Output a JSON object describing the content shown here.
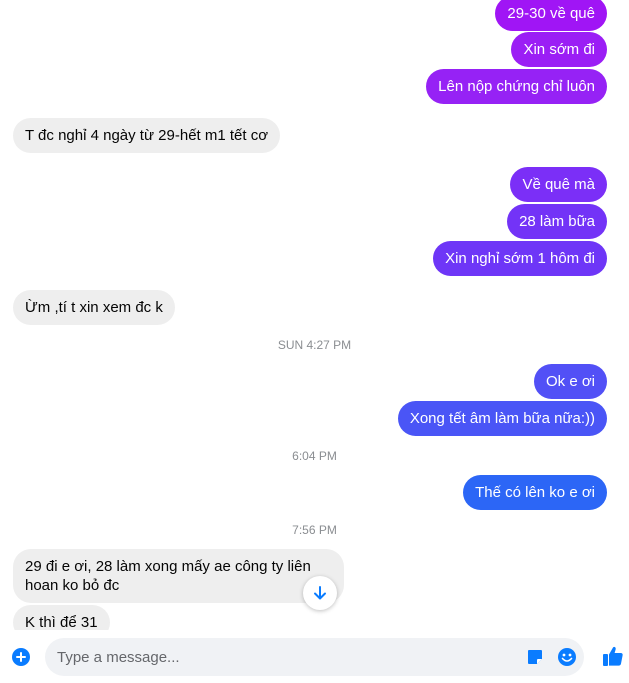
{
  "messages": {
    "m1": "29-30 về quê",
    "m2": "Xin sớm đi",
    "m3": "Lên nộp chứng chỉ luôn",
    "m4": "T đc nghỉ 4 ngày từ 29-hết m1 tết cơ",
    "m5": "Về quê mà",
    "m6": "28 làm bữa",
    "m7": "Xin nghỉ sớm 1 hôm đi",
    "m8": "Ừm ,tí t xin xem đc k",
    "ts1": "SUN 4:27 PM",
    "m9": "Ok e ơi",
    "m10": "Xong tết âm làm bữa nữa:))",
    "ts2": "6:04 PM",
    "m11": "Thế có lên ko e ơi",
    "ts3": "7:56 PM",
    "m12": "29 đi e ơi, 28 làm xong mấy ae  công ty liên hoan ko bỏ đc",
    "m13": "K thì để 31"
  },
  "colors": {
    "outgoing_purple": "#9b1ef5",
    "outgoing_violet": "#7b2ff7",
    "outgoing_indigo": "#5b46f6",
    "outgoing_blue": "#3566f5",
    "incoming_bg": "#eeeeee",
    "accent": "#0a7cff"
  },
  "composer": {
    "placeholder": "Type a message..."
  },
  "icons": {
    "plus": "plus-icon",
    "sticker": "sticker-icon",
    "emoji": "emoji-icon",
    "like": "thumbs-up-icon",
    "scroll": "arrow-down-icon"
  }
}
